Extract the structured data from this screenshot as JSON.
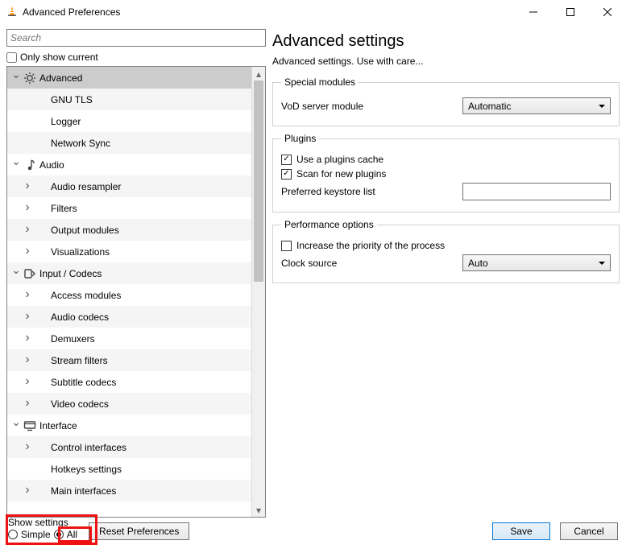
{
  "window": {
    "title": "Advanced Preferences"
  },
  "search": {
    "placeholder": "Search"
  },
  "only_show_current": {
    "label": "Only show current",
    "checked": false
  },
  "tree": {
    "items": [
      {
        "kind": "cat",
        "expanded": true,
        "icon": "gear",
        "label": "Advanced",
        "selected": true
      },
      {
        "kind": "leaf2",
        "label": "GNU TLS"
      },
      {
        "kind": "leaf2",
        "label": "Logger"
      },
      {
        "kind": "leaf2",
        "label": "Network Sync"
      },
      {
        "kind": "cat",
        "expanded": true,
        "icon": "audio",
        "label": "Audio"
      },
      {
        "kind": "group",
        "label": "Audio resampler"
      },
      {
        "kind": "group",
        "label": "Filters"
      },
      {
        "kind": "group",
        "label": "Output modules"
      },
      {
        "kind": "group",
        "label": "Visualizations"
      },
      {
        "kind": "cat",
        "expanded": true,
        "icon": "input",
        "label": "Input / Codecs"
      },
      {
        "kind": "group",
        "label": "Access modules"
      },
      {
        "kind": "group",
        "label": "Audio codecs"
      },
      {
        "kind": "group",
        "label": "Demuxers"
      },
      {
        "kind": "group",
        "label": "Stream filters"
      },
      {
        "kind": "group",
        "label": "Subtitle codecs"
      },
      {
        "kind": "group",
        "label": "Video codecs"
      },
      {
        "kind": "cat",
        "expanded": true,
        "icon": "interface",
        "label": "Interface"
      },
      {
        "kind": "group",
        "label": "Control interfaces"
      },
      {
        "kind": "leaf2",
        "label": "Hotkeys settings"
      },
      {
        "kind": "group",
        "label": "Main interfaces"
      }
    ]
  },
  "right": {
    "title": "Advanced settings",
    "subtitle": "Advanced settings. Use with care...",
    "special": {
      "legend": "Special modules",
      "vod_label": "VoD server module",
      "vod_value": "Automatic"
    },
    "plugins": {
      "legend": "Plugins",
      "use_cache": {
        "label": "Use a plugins cache",
        "checked": true
      },
      "scan_new": {
        "label": "Scan for new plugins",
        "checked": true
      },
      "keystore_label": "Preferred keystore list",
      "keystore_value": ""
    },
    "perf": {
      "legend": "Performance options",
      "increase_priority": {
        "label": "Increase the priority of the process",
        "checked": false
      },
      "clock_label": "Clock source",
      "clock_value": "Auto"
    }
  },
  "bottom": {
    "show_settings_label": "Show settings",
    "simple_label": "Simple",
    "all_label": "All",
    "selected": "all",
    "reset_label": "Reset Preferences",
    "save_label": "Save",
    "cancel_label": "Cancel"
  }
}
